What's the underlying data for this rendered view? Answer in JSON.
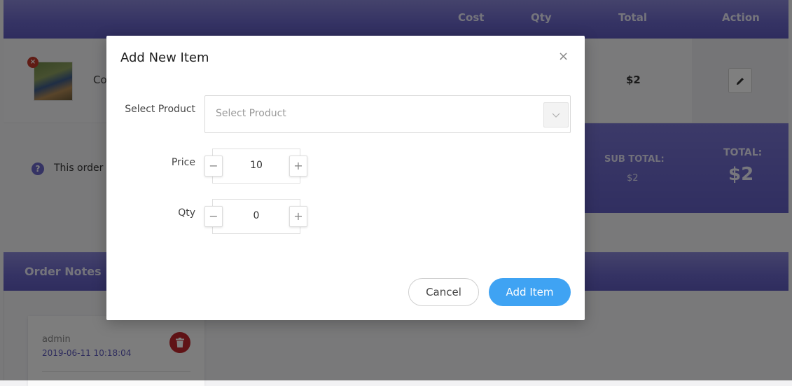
{
  "order_table": {
    "columns": {
      "cost": "Cost",
      "qty": "Qty",
      "total": "Total",
      "action": "Action"
    },
    "item": {
      "name_visible": "Co",
      "total": "$2"
    }
  },
  "summary": {
    "order_info_visible": "This order i",
    "sub_total_label": "SUB TOTAL:",
    "sub_total_value": "$2",
    "total_label": "TOTAL:",
    "total_value": "$2"
  },
  "notes": {
    "title": "Order Notes",
    "entries": [
      {
        "author": "admin",
        "date": "2019-06-11 10:18:04"
      }
    ]
  },
  "modal": {
    "title": "Add New Item",
    "select_product_label": "Select Product",
    "select_product_placeholder": "Select Product",
    "price_label": "Price",
    "price_value": "10",
    "qty_label": "Qty",
    "qty_value": "0",
    "cancel_label": "Cancel",
    "add_label": "Add Item"
  },
  "colors": {
    "header_purple": "#6a66c8",
    "accent_blue": "#3fa3f3",
    "danger_red": "#c0262d"
  }
}
